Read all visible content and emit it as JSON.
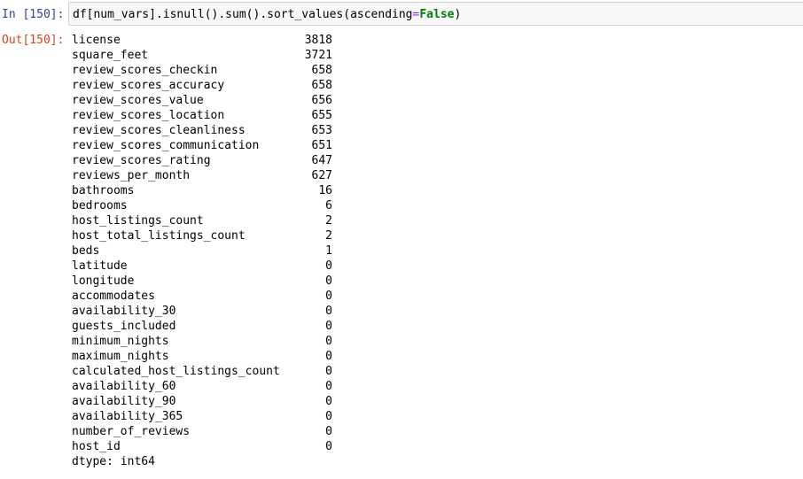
{
  "input_cell": {
    "prompt": "In [150]:",
    "code": {
      "prefix": "df[num_vars].isnull().sum().sort_values(ascending",
      "equals": "=",
      "keyword": "False",
      "suffix": ")"
    }
  },
  "output_cell": {
    "prompt": "Out[150]:",
    "series": [
      {
        "name": "license",
        "value": "3818"
      },
      {
        "name": "square_feet",
        "value": "3721"
      },
      {
        "name": "review_scores_checkin",
        "value": "658"
      },
      {
        "name": "review_scores_accuracy",
        "value": "658"
      },
      {
        "name": "review_scores_value",
        "value": "656"
      },
      {
        "name": "review_scores_location",
        "value": "655"
      },
      {
        "name": "review_scores_cleanliness",
        "value": "653"
      },
      {
        "name": "review_scores_communication",
        "value": "651"
      },
      {
        "name": "review_scores_rating",
        "value": "647"
      },
      {
        "name": "reviews_per_month",
        "value": "627"
      },
      {
        "name": "bathrooms",
        "value": "16"
      },
      {
        "name": "bedrooms",
        "value": "6"
      },
      {
        "name": "host_listings_count",
        "value": "2"
      },
      {
        "name": "host_total_listings_count",
        "value": "2"
      },
      {
        "name": "beds",
        "value": "1"
      },
      {
        "name": "latitude",
        "value": "0"
      },
      {
        "name": "longitude",
        "value": "0"
      },
      {
        "name": "accommodates",
        "value": "0"
      },
      {
        "name": "availability_30",
        "value": "0"
      },
      {
        "name": "guests_included",
        "value": "0"
      },
      {
        "name": "minimum_nights",
        "value": "0"
      },
      {
        "name": "maximum_nights",
        "value": "0"
      },
      {
        "name": "calculated_host_listings_count",
        "value": "0"
      },
      {
        "name": "availability_60",
        "value": "0"
      },
      {
        "name": "availability_90",
        "value": "0"
      },
      {
        "name": "availability_365",
        "value": "0"
      },
      {
        "name": "number_of_reviews",
        "value": "0"
      },
      {
        "name": "host_id",
        "value": "0"
      }
    ],
    "dtype": "dtype: int64"
  }
}
